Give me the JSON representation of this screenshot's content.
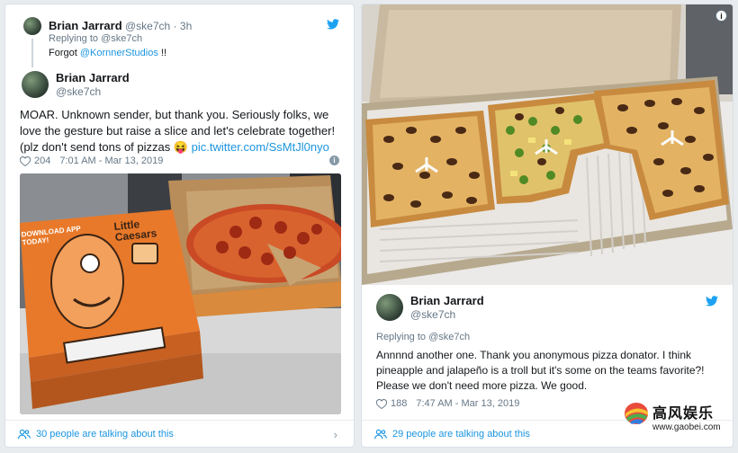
{
  "left_tweet": {
    "reply": {
      "name": "Brian Jarrard",
      "handle": "@ske7ch",
      "time": "3h",
      "replying_to": "Replying to @ske7ch",
      "text_prefix": "Forgot ",
      "mention": "@KornnerStudios",
      "text_suffix": " !!"
    },
    "main": {
      "name": "Brian Jarrard",
      "handle": "@ske7ch",
      "text": "MOAR. Unknown sender, but thank you. Seriously folks, we love the gesture but raise a slice and let's celebrate together! (plz don't send tons of pizzas ",
      "emoji": "😝",
      "link": "pic.twitter.com/SsMtJl0nyo",
      "likes": "204",
      "timestamp": "7:01 AM - Mar 13, 2019"
    },
    "photo_box_text": {
      "brand": "Little Caesars",
      "app_banner": "DOWNLOAD APP TODAY!"
    },
    "footer": "30 people are talking about this"
  },
  "right_tweet": {
    "name": "Brian Jarrard",
    "handle": "@ske7ch",
    "replying_to": "Replying to @ske7ch",
    "text": "Annnnd another one. Thank you anonymous pizza donator. I think pineapple and jalapeño is a troll but it's some on the teams favorite?! Please we don't need more pizza. We good.",
    "likes": "188",
    "timestamp": "7:47 AM - Mar 13, 2019",
    "footer": "29 people are talking about this"
  },
  "watermark": {
    "title": "高风娱乐",
    "url": "www.gaobei.com"
  },
  "colors": {
    "link": "#1b95e0",
    "muted": "#657786",
    "box_orange": "#e8792a"
  },
  "icons": {
    "bird": "twitter-bird-icon",
    "heart": "heart-icon",
    "info": "info-icon",
    "people": "people-icon",
    "chevron": "chevron-right-icon"
  }
}
